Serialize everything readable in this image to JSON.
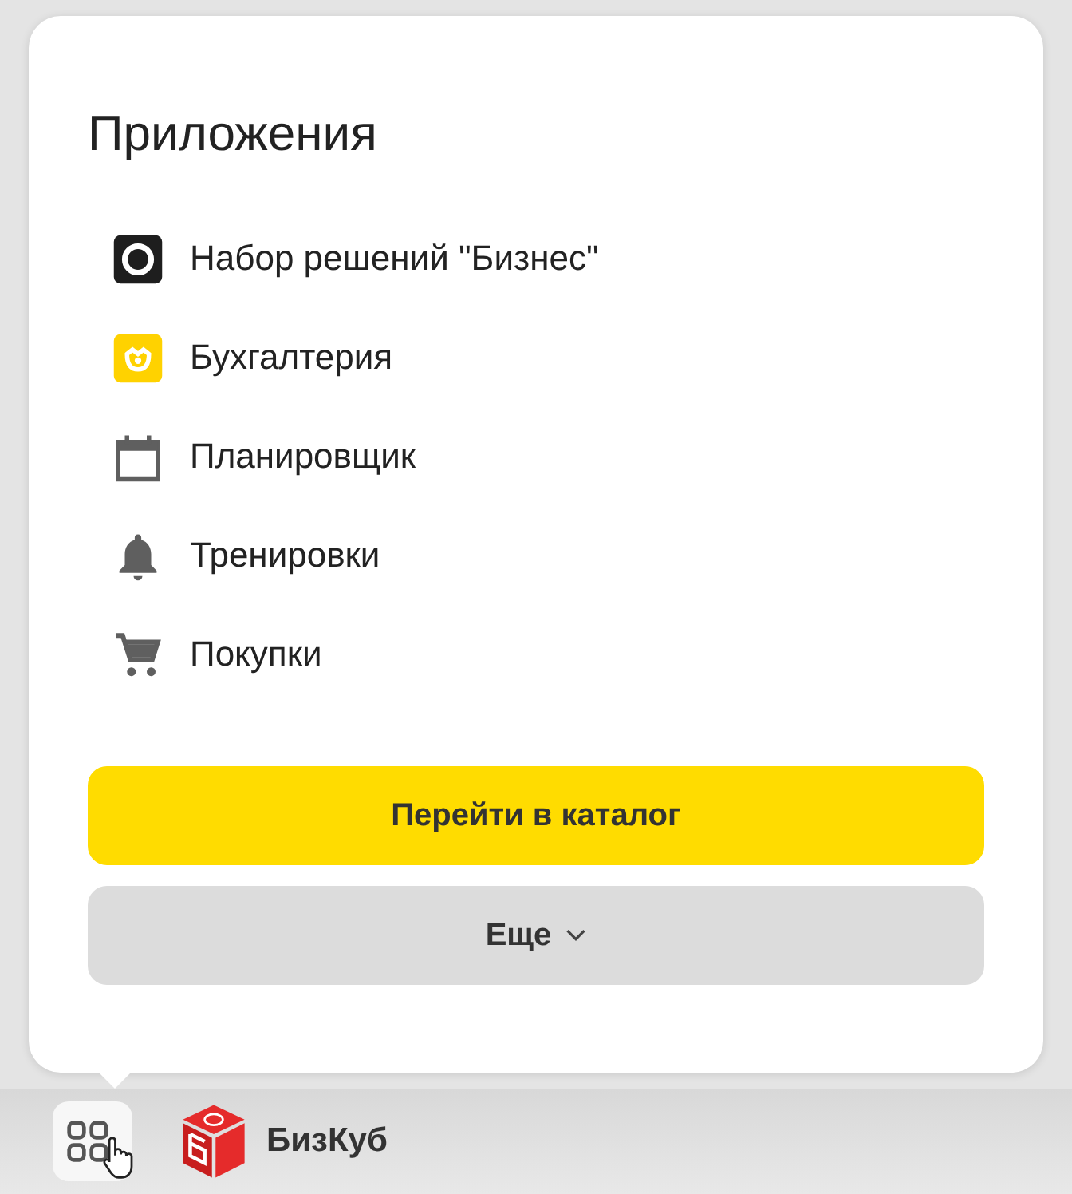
{
  "popup": {
    "title": "Приложения",
    "items": [
      {
        "label": "Набор решений \"Бизнес\"",
        "kind": "business"
      },
      {
        "label": "Бухгалтерия",
        "kind": "accounting"
      },
      {
        "label": "Планировщик",
        "kind": "calendar"
      },
      {
        "label": "Тренировки",
        "kind": "bell"
      },
      {
        "label": "Покупки",
        "kind": "cart"
      }
    ],
    "catalog_button": "Перейти в каталог",
    "more_button": "Еще"
  },
  "taskbar": {
    "app_name": "БизКуб"
  }
}
